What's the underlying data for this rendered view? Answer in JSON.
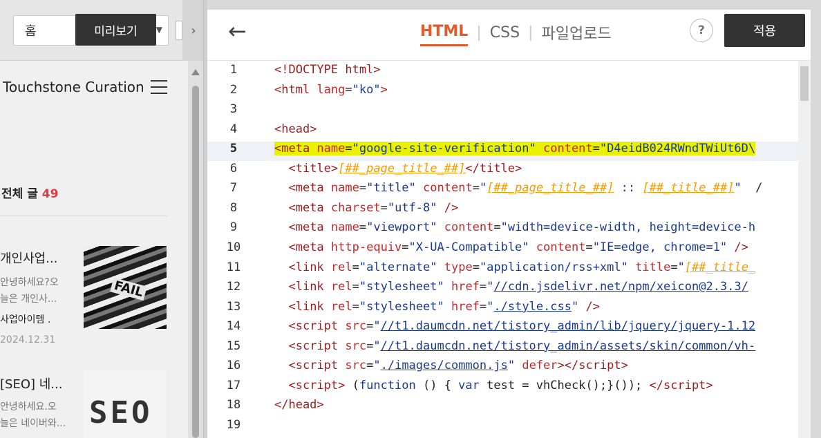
{
  "left": {
    "page_select": "홈",
    "preview_tooltip": "미리보기",
    "collapse_glyph": "›",
    "blog_title": "Touchstone Curation",
    "total_label": "전체 글",
    "total_count": "49",
    "posts": [
      {
        "title": "개인사업...",
        "desc1": "안녕하세요?오",
        "desc2": "늘은 개인사...",
        "category": "사업아이템 .",
        "date": "2024.12.31",
        "thumb_text": "FAIL"
      },
      {
        "title": "[SEO] 네...",
        "desc1": "안녕하세요.오",
        "desc2": "늘은 네이버와...",
        "thumb_text": "SEO"
      }
    ]
  },
  "editor": {
    "back_glyph": "←",
    "tabs": [
      {
        "label": "HTML",
        "active": true
      },
      {
        "label": "CSS",
        "active": false
      },
      {
        "label": "파일업로드",
        "active": false
      }
    ],
    "help_label": "?",
    "apply_label": "적용",
    "lines": [
      {
        "n": "1",
        "html": "<span class='tg'>&lt;!DOCTYPE html&gt;</span>"
      },
      {
        "n": "2",
        "html": "<span class='tg'>&lt;html</span> <span class='at'>lang</span>=<span class='st'>\"ko\"</span><span class='tg'>&gt;</span>"
      },
      {
        "n": "3",
        "html": ""
      },
      {
        "n": "4",
        "html": "<span class='tg'>&lt;head&gt;</span>"
      },
      {
        "n": "5",
        "html": "<span class='hl'><span class='tg'>&lt;meta</span> <span class='at'>name</span>=<span class='st'>\"google-site-verification\"</span> <span class='at'>content</span>=<span class='st'>\"D4eidB024RWndTWiUt6D\\</span></span>",
        "current": true
      },
      {
        "n": "6",
        "html": "  <span class='tg'>&lt;title&gt;</span><span class='ph'>[##_page_title_##]</span><span class='tg'>&lt;/title&gt;</span>"
      },
      {
        "n": "7",
        "html": "  <span class='tg'>&lt;meta</span> <span class='at'>name</span>=<span class='st'>\"title\"</span> <span class='at'>content</span>=<span class='st'>\"</span><span class='ph'>[##_page_title_##]</span><span class='st'> :: </span><span class='ph'>[##_title_##]</span><span class='st'>\"</span>  /"
      },
      {
        "n": "8",
        "html": "  <span class='tg'>&lt;meta</span> <span class='at'>charset</span>=<span class='st'>\"utf-8\"</span> <span class='tg'>/&gt;</span>"
      },
      {
        "n": "9",
        "html": "  <span class='tg'>&lt;meta</span> <span class='at'>name</span>=<span class='st'>\"viewport\"</span> <span class='at'>content</span>=<span class='st'>\"width=device-width, height=device-h</span>"
      },
      {
        "n": "10",
        "html": "  <span class='tg'>&lt;meta</span> <span class='at'>http-equiv</span>=<span class='st'>\"X-UA-Compatible\"</span> <span class='at'>content</span>=<span class='st'>\"IE=edge, chrome=1\"</span> <span class='tg'>/&gt;</span>"
      },
      {
        "n": "11",
        "html": "  <span class='tg'>&lt;link</span> <span class='at'>rel</span>=<span class='st'>\"alternate\"</span> <span class='at'>type</span>=<span class='st'>\"application/rss+xml\"</span> <span class='at'>title</span>=<span class='st'>\"</span><span class='ph'>[##_title_</span>"
      },
      {
        "n": "12",
        "html": "  <span class='tg'>&lt;link</span> <span class='at'>rel</span>=<span class='st'>\"stylesheet\"</span> <span class='at'>href</span>=<span class='st'>\"</span><span class='ur'>//cdn.jsdelivr.net/npm/xeicon@2.3.3/</span>"
      },
      {
        "n": "13",
        "html": "  <span class='tg'>&lt;link</span> <span class='at'>rel</span>=<span class='st'>\"stylesheet\"</span> <span class='at'>href</span>=<span class='st'>\"</span><span class='ur'>./style.css</span><span class='st'>\"</span> <span class='tg'>/&gt;</span>"
      },
      {
        "n": "14",
        "html": "  <span class='tg'>&lt;script</span> <span class='at'>src</span>=<span class='st'>\"</span><span class='ur'>//t1.daumcdn.net/tistory_admin/lib/jquery/jquery-1.12</span>"
      },
      {
        "n": "15",
        "html": "  <span class='tg'>&lt;script</span> <span class='at'>src</span>=<span class='st'>\"</span><span class='ur'>//t1.daumcdn.net/tistory_admin/assets/skin/common/vh-</span>"
      },
      {
        "n": "16",
        "html": "  <span class='tg'>&lt;script</span> <span class='at'>src</span>=<span class='st'>\"</span><span class='ur'>./images/common.js</span><span class='st'>\"</span> <span class='at'>defer</span><span class='tg'>&gt;&lt;/script&gt;</span>"
      },
      {
        "n": "17",
        "html": "  <span class='tg'>&lt;script&gt;</span> (<span class='kw'>function</span> () { <span class='kw'>var</span> test = vhCheck();}()); <span class='tg'>&lt;/script&gt;</span>"
      },
      {
        "n": "18",
        "html": "<span class='tg'>&lt;/head&gt;</span>"
      },
      {
        "n": "19",
        "html": ""
      }
    ]
  }
}
